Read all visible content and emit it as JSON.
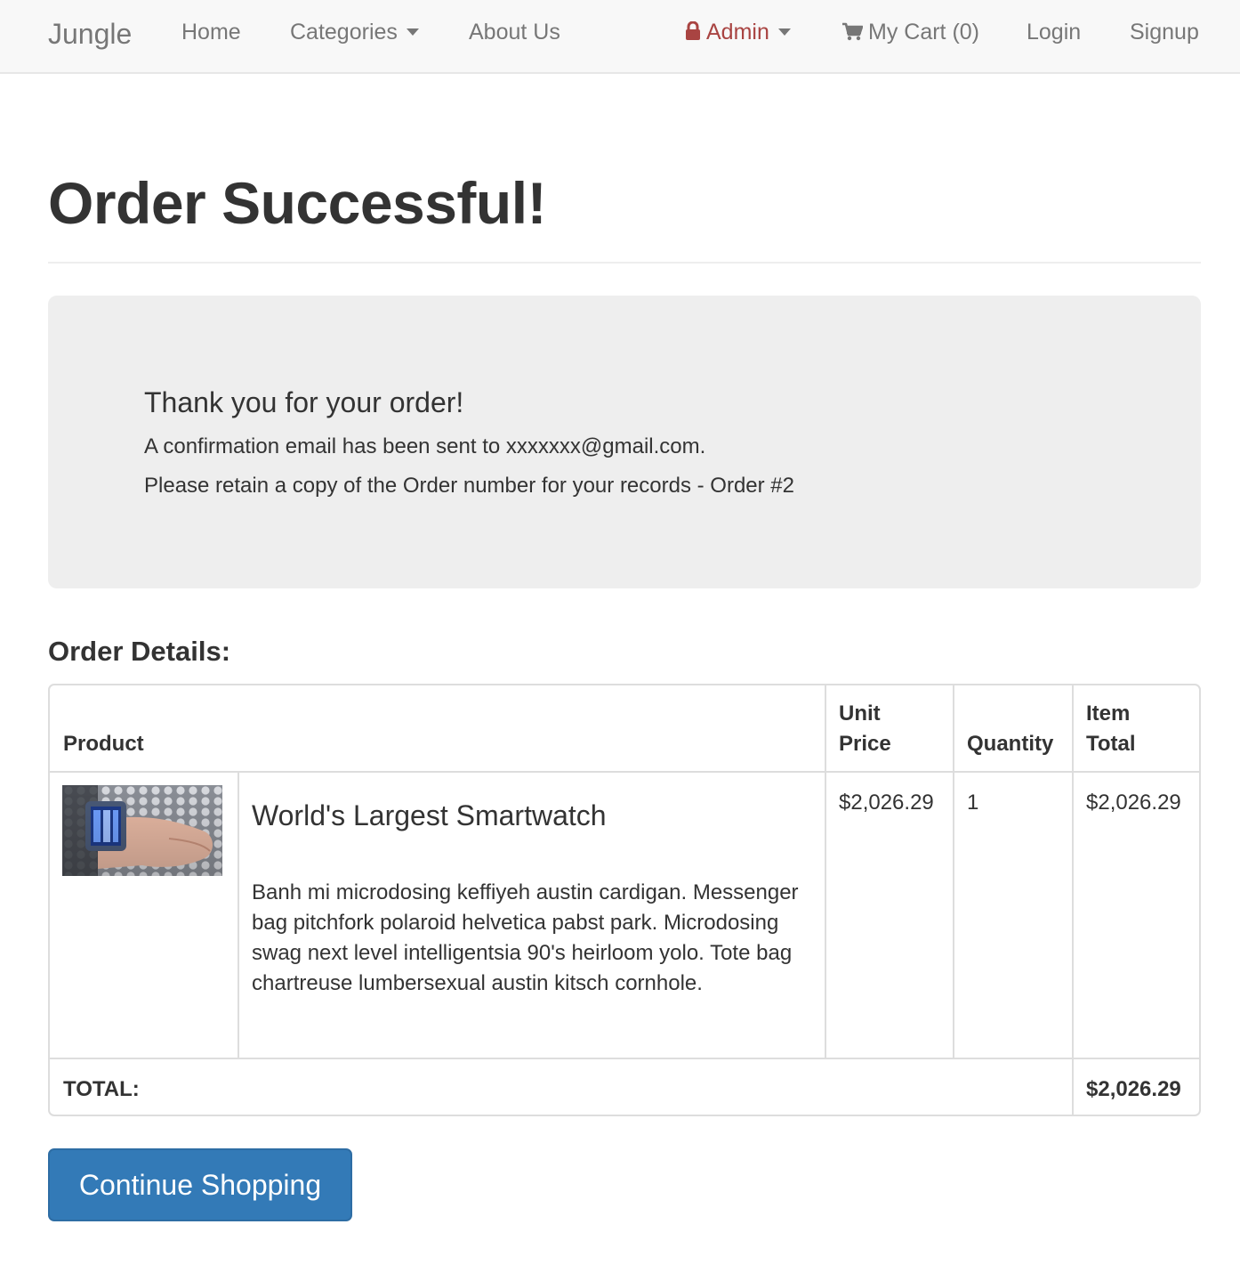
{
  "navbar": {
    "brand": "Jungle",
    "home": "Home",
    "categories": "Categories",
    "about": "About Us",
    "admin": "Admin",
    "cart": "My Cart (0)",
    "login": "Login",
    "signup": "Signup"
  },
  "page": {
    "title": "Order Successful!"
  },
  "confirmation": {
    "heading": "Thank you for your order!",
    "email_line": "A confirmation email has been sent to xxxxxxx@gmail.com.",
    "order_line": "Please retain a copy of the Order number for your records - Order #2"
  },
  "order": {
    "heading": "Order Details:",
    "columns": {
      "product": "Product",
      "unit_price_1": "Unit",
      "unit_price_2": "Price",
      "quantity": "Quantity",
      "item_total_1": "Item",
      "item_total_2": "Total"
    },
    "items": [
      {
        "name": "World's Largest Smartwatch",
        "description": "Banh mi microdosing keffiyeh austin cardigan. Messenger bag pitchfork polaroid helvetica pabst park. Microdosing swag next level intelligentsia 90's heirloom yolo. Tote bag chartreuse lumbersexual austin kitsch cornhole.",
        "unit_price": "$2,026.29",
        "quantity": "1",
        "item_total": "$2,026.29"
      }
    ],
    "total_label": "TOTAL:",
    "total_value": "$2,026.29"
  },
  "actions": {
    "continue_shopping": "Continue Shopping"
  },
  "colors": {
    "primary": "#337ab7",
    "admin": "#a94442",
    "navbar_bg": "#f8f8f8",
    "jumbotron_bg": "#eeeeee"
  }
}
